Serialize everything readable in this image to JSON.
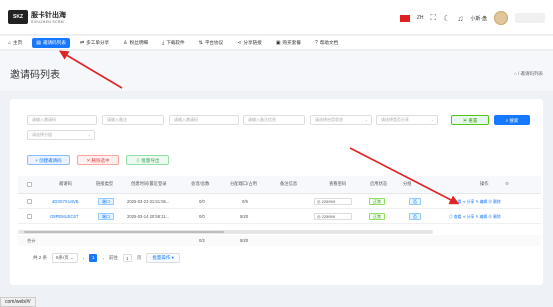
{
  "header": {
    "logo_text": "SKZ",
    "brand_cn": "服卡针出海",
    "brand_en": "SIXUZHEN SCRM",
    "lang": "ZH",
    "user_name": "小斯·盘"
  },
  "nav": [
    {
      "icon": "home-icon",
      "glyph": "⌂",
      "label": "主页"
    },
    {
      "icon": "list-icon",
      "glyph": "▤",
      "label": "邀请码列表"
    },
    {
      "icon": "share-icon",
      "glyph": "⇄",
      "label": "多工单分享"
    },
    {
      "icon": "user-icon",
      "glyph": "♙",
      "label": "粉丝明细"
    },
    {
      "icon": "download-icon",
      "glyph": "⤓",
      "label": "下载软件"
    },
    {
      "icon": "platform-icon",
      "glyph": "⇅",
      "label": "平台协议"
    },
    {
      "icon": "share-link-icon",
      "glyph": "⋖",
      "label": "分享链接"
    },
    {
      "icon": "cart-icon",
      "glyph": "▣",
      "label": "购买套餐"
    },
    {
      "icon": "help-icon",
      "glyph": "?",
      "label": "帮助文档"
    }
  ],
  "page": {
    "title": "邀请码列表",
    "breadcrumb": "⌂ / 邀请码列表"
  },
  "filters": {
    "row1": [
      "请输入邀请码",
      "请输入备注",
      "请输入邀请码",
      "请输入备注信息",
      "请选择启用状态",
      "请选择是否分享"
    ],
    "row2": [
      "请选择分组"
    ],
    "reset": "重置",
    "search": "搜索"
  },
  "actions": {
    "create": "+ 创建邀请码",
    "delete": "✕ 删除选中",
    "export": "⇩ 批量导出"
  },
  "table": {
    "columns": [
      "邀请码",
      "链接类型",
      "创建时间/最近登录",
      "会话/总数",
      "分配端口/占用",
      "备注信息",
      "查看密码",
      "启用状态",
      "分组",
      "操作"
    ],
    "rows": [
      {
        "code": "4DX57XU4VB",
        "type": "端口",
        "time": "2025-03-23 01:51:55...",
        "sessions": "0/0",
        "ports": "0/9",
        "note": "",
        "password": "225959",
        "status": "正常",
        "share": "否",
        "ops": "◎ 查看  ⋖ 分享  ✎ 编辑  ⊘ 删除"
      },
      {
        "code": "G8PEMUSC6T",
        "type": "端口",
        "time": "2025-03-14 20:58:11...",
        "sessions": "0/0",
        "ports": "50/0",
        "note": "",
        "password": "225959",
        "status": "正常",
        "share": "否",
        "ops": "◎ 查看  ⋖ 分享  ✎ 编辑  ⊘ 删除"
      }
    ],
    "sum_label": "合计",
    "sum_sessions": "0/2",
    "sum_ports": "50/0"
  },
  "pager": {
    "total": "共 2 条",
    "page_size": "5条/页",
    "prev": "‹",
    "current": "1",
    "next": "›",
    "goto_label": "前往",
    "goto_value": "1",
    "goto_unit": "页",
    "batch_btn": "批量操作 ▾"
  },
  "status_url": "com/web/#/",
  "colors": {
    "primary": "#1677ff",
    "success": "#52c41a",
    "danger": "#e84040",
    "arrow": "#e02424"
  }
}
